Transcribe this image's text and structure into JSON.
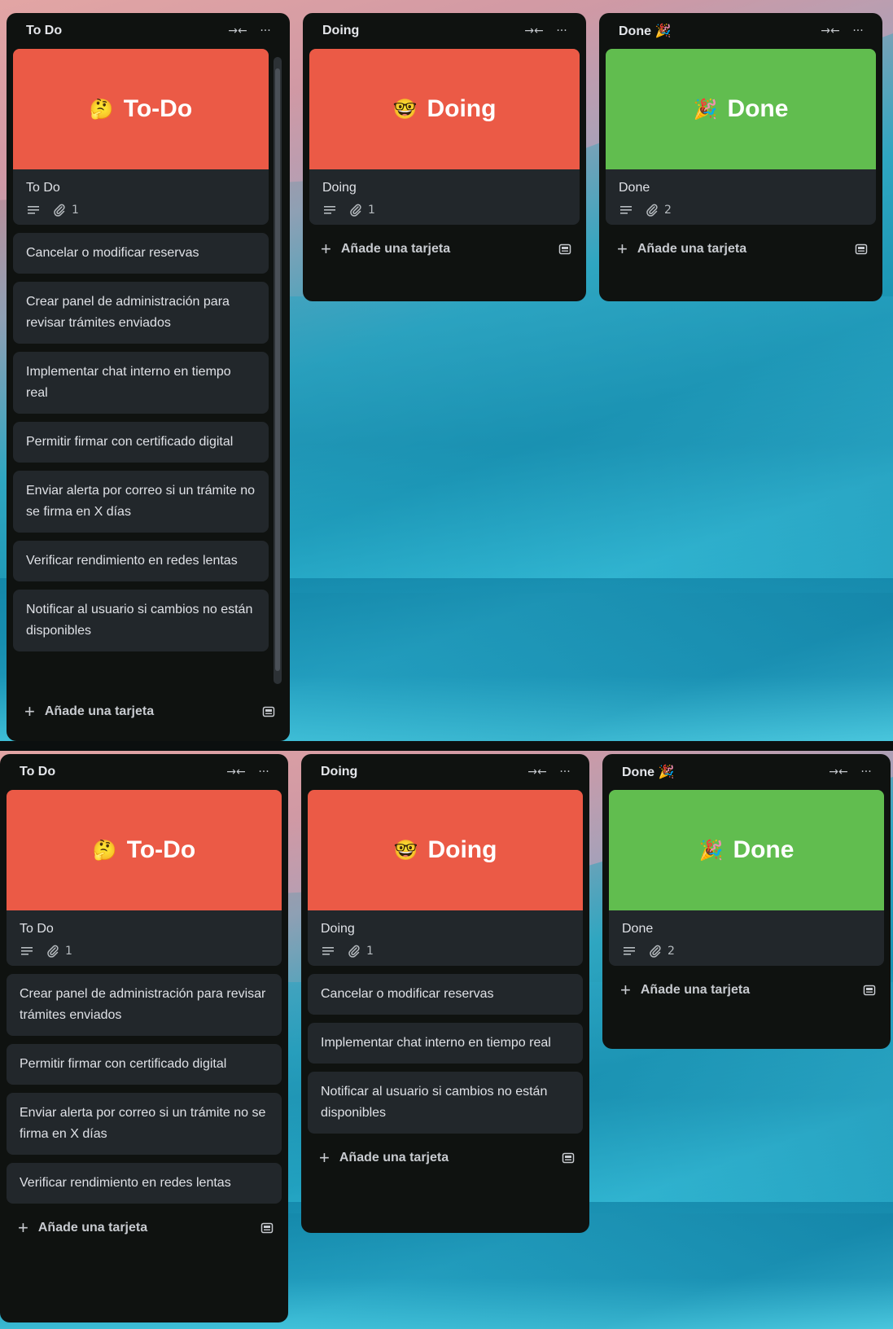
{
  "colors": {
    "list_bg": "#0f1210",
    "card_bg": "#22272b",
    "cover_red": "#eb5a46",
    "cover_green": "#61bd4f",
    "text": "#dfe1e6"
  },
  "icons": {
    "collapse": "collapse-arrows-icon",
    "more": "more-dots-icon",
    "description": "description-lines-icon",
    "attachment": "paperclip-icon",
    "template": "card-template-icon",
    "plus": "plus-icon"
  },
  "common": {
    "add_card_label": "Añade una tarjeta",
    "more_glyph": "···",
    "collapse_glyph": "→←"
  },
  "panel1": {
    "todo": {
      "title": "To Do",
      "cover": {
        "emoji": "🤔",
        "text": "To-Do"
      },
      "cover_card": {
        "title": "To Do",
        "attachments": "1"
      },
      "cards": [
        "Cancelar o modificar reservas",
        "Crear panel de administración para revisar trámites enviados",
        "Implementar chat interno en tiempo real",
        "Permitir firmar con certificado digital",
        "Enviar alerta por correo si un trámite no se firma en X días",
        "Verificar rendimiento en redes lentas",
        "Notificar al usuario si cambios no están disponibles"
      ]
    },
    "doing": {
      "title": "Doing",
      "cover": {
        "emoji": "🤓",
        "text": "Doing"
      },
      "cover_card": {
        "title": "Doing",
        "attachments": "1"
      }
    },
    "done": {
      "title": "Done 🎉",
      "cover": {
        "emoji": "🎉",
        "text": "Done"
      },
      "cover_card": {
        "title": "Done",
        "attachments": "2"
      }
    }
  },
  "panel2": {
    "todo": {
      "title": "To Do",
      "cover": {
        "emoji": "🤔",
        "text": "To-Do"
      },
      "cover_card": {
        "title": "To Do",
        "attachments": "1"
      },
      "cards": [
        "Crear panel de administración para revisar trámites enviados",
        "Permitir firmar con certificado digital",
        "Enviar alerta por correo si un trámite no se firma en X días",
        "Verificar rendimiento en redes lentas"
      ]
    },
    "doing": {
      "title": "Doing",
      "cover": {
        "emoji": "🤓",
        "text": "Doing"
      },
      "cover_card": {
        "title": "Doing",
        "attachments": "1"
      },
      "cards": [
        "Cancelar o modificar reservas",
        "Implementar chat interno en tiempo real",
        "Notificar al usuario si cambios no están disponibles"
      ]
    },
    "done": {
      "title": "Done 🎉",
      "cover": {
        "emoji": "🎉",
        "text": "Done"
      },
      "cover_card": {
        "title": "Done",
        "attachments": "2"
      }
    }
  }
}
